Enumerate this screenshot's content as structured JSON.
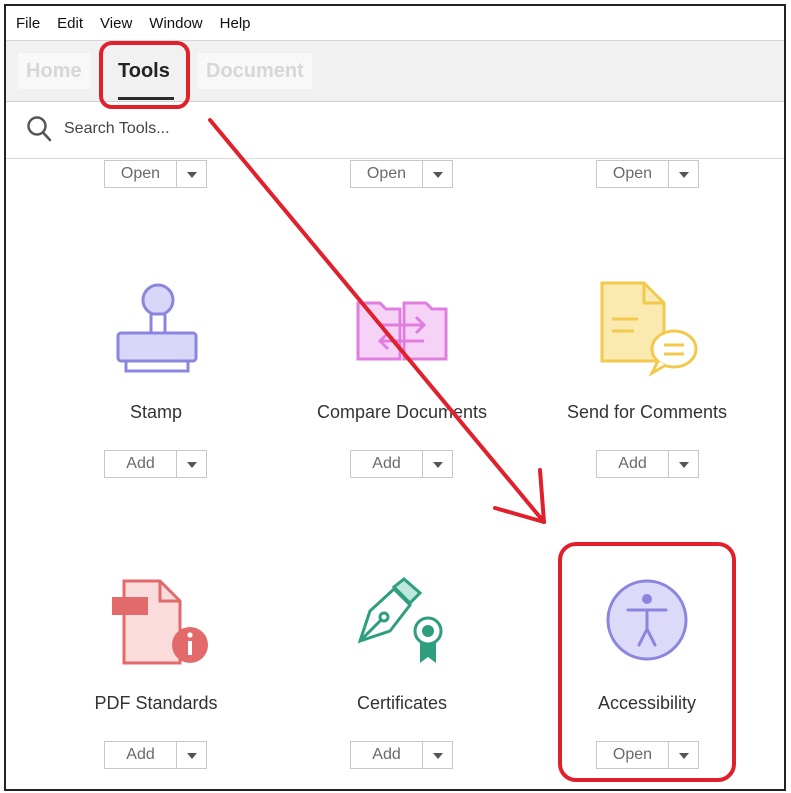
{
  "menu": {
    "items": [
      "File",
      "Edit",
      "View",
      "Window",
      "Help"
    ]
  },
  "tabs": {
    "home": "Home",
    "tools": "Tools",
    "document": "Document"
  },
  "search": {
    "placeholder": "Search Tools..."
  },
  "top_row": [
    {
      "button": "Open"
    },
    {
      "button": "Open"
    },
    {
      "button": "Open"
    }
  ],
  "tools": [
    {
      "name": "Stamp",
      "button": "Add",
      "icon": "stamp-icon",
      "color": "#8a86e0"
    },
    {
      "name": "Compare Documents",
      "button": "Add",
      "icon": "compare-documents-icon",
      "color": "#e07ee0"
    },
    {
      "name": "Send for Comments",
      "button": "Add",
      "icon": "send-for-comments-icon",
      "color": "#f2c94c"
    },
    {
      "name": "PDF Standards",
      "button": "Add",
      "icon": "pdf-standards-icon",
      "color": "#e36a6a"
    },
    {
      "name": "Certificates",
      "button": "Add",
      "icon": "certificates-icon",
      "color": "#2e9e7e"
    },
    {
      "name": "Accessibility",
      "button": "Open",
      "icon": "accessibility-icon",
      "color": "#8a86e0"
    }
  ],
  "annotations": {
    "highlight_color": "#e0202a"
  }
}
